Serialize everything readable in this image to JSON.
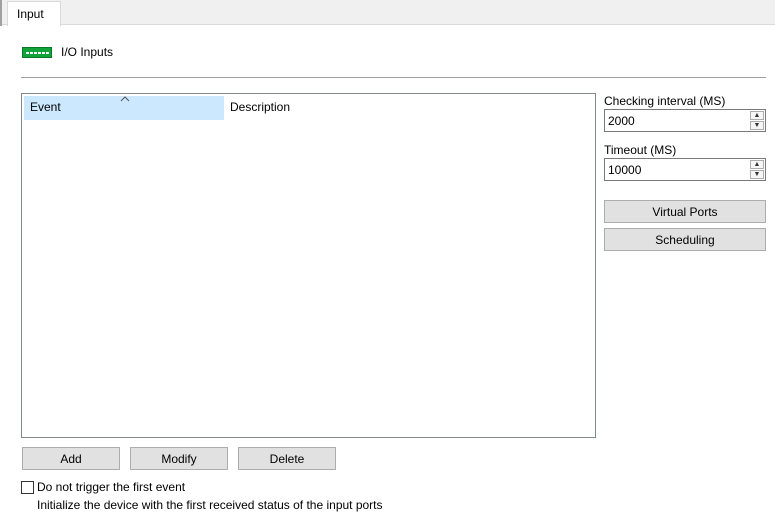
{
  "tabs": [
    {
      "label": "Input"
    }
  ],
  "header": {
    "title": "I/O Inputs",
    "icon": "io-ports-icon",
    "icon_color": "#0fa33a"
  },
  "list": {
    "columns": [
      {
        "label": "Event"
      },
      {
        "label": "Description"
      }
    ],
    "sorted_column": "Event",
    "rows": []
  },
  "settings": {
    "checking_interval": {
      "label": "Checking interval (MS)",
      "value": "2000"
    },
    "timeout": {
      "label": "Timeout (MS)",
      "value": "10000"
    }
  },
  "buttons": {
    "virtual_ports": "Virtual Ports",
    "scheduling": "Scheduling",
    "add": "Add",
    "modify": "Modify",
    "delete": "Delete"
  },
  "options": {
    "skip_first_event": {
      "label": "Do not trigger the first event",
      "checked": false,
      "hint": "Initialize the device with the first received status of the input ports"
    }
  },
  "colors": {
    "selection": "#cce8ff",
    "button_bg": "#e1e1e1"
  }
}
